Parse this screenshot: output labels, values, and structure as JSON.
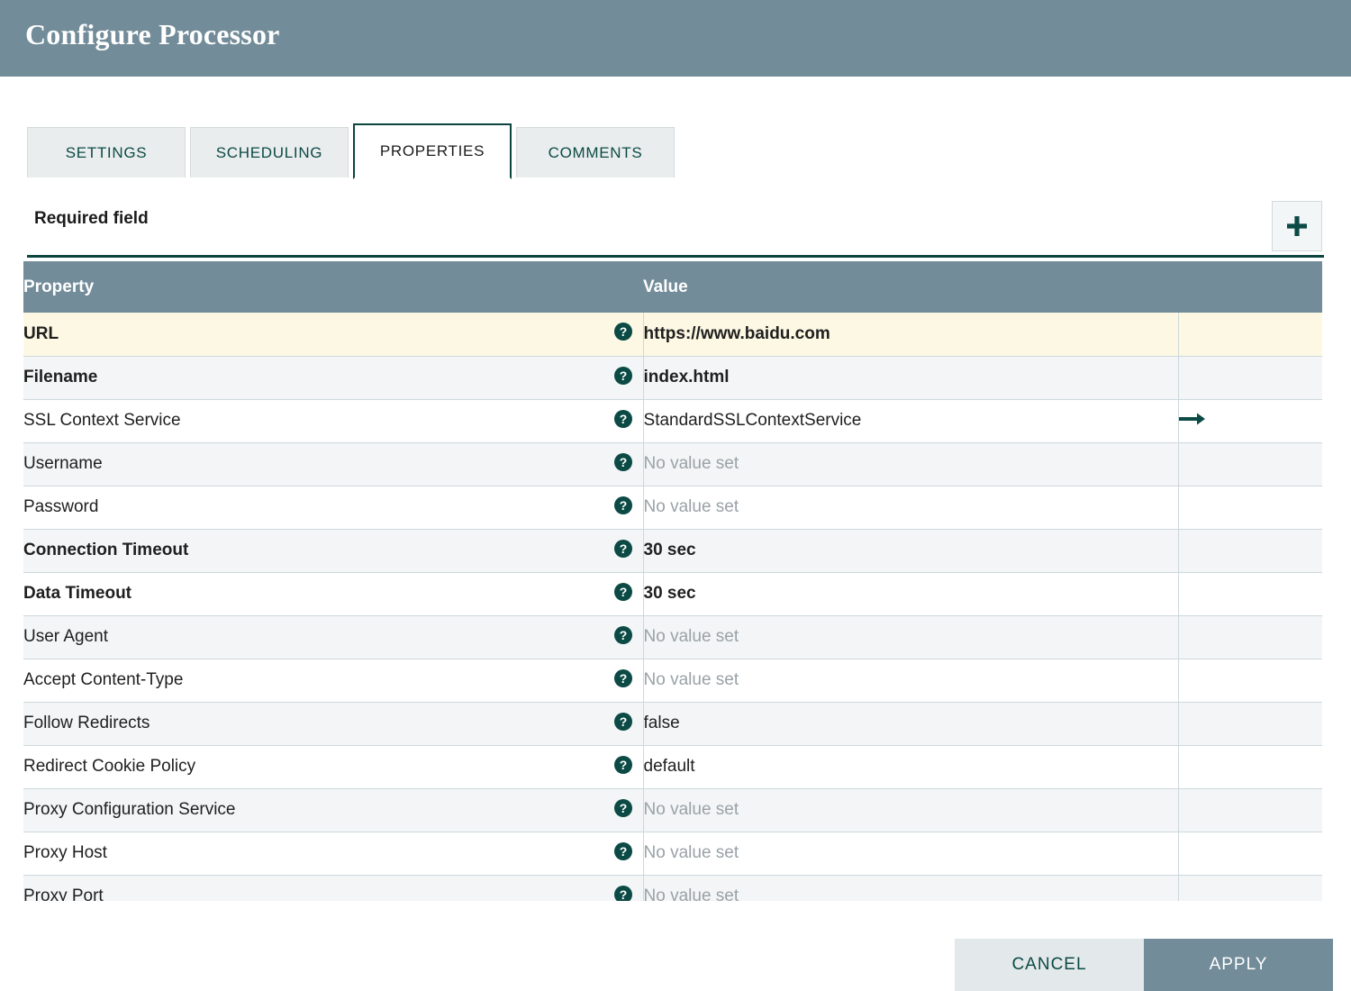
{
  "window": {
    "title": "Configure Processor",
    "header_bg": "#728c99",
    "accent": "#0c4540"
  },
  "tabs": [
    {
      "label": "SETTINGS",
      "active": false
    },
    {
      "label": "SCHEDULING",
      "active": false
    },
    {
      "label": "PROPERTIES",
      "active": true
    },
    {
      "label": "COMMENTS",
      "active": false
    }
  ],
  "toolbar": {
    "required_field_label": "Required field",
    "add_property_icon": "plus-icon"
  },
  "table": {
    "columns": [
      "Property",
      "Value",
      ""
    ],
    "help_icon": "help-circle-icon",
    "goto_icon": "arrow-right-icon",
    "empty_value_text": "No value set",
    "rows": [
      {
        "property": "URL",
        "value": "https://www.baidu.com",
        "required": true,
        "empty": false,
        "highlight": true,
        "action": ""
      },
      {
        "property": "Filename",
        "value": "index.html",
        "required": true,
        "empty": false,
        "highlight": false,
        "action": ""
      },
      {
        "property": "SSL Context Service",
        "value": "StandardSSLContextService",
        "required": false,
        "empty": false,
        "highlight": false,
        "action": "arrow-right-icon"
      },
      {
        "property": "Username",
        "value": "No value set",
        "required": false,
        "empty": true,
        "highlight": false,
        "action": ""
      },
      {
        "property": "Password",
        "value": "No value set",
        "required": false,
        "empty": true,
        "highlight": false,
        "action": ""
      },
      {
        "property": "Connection Timeout",
        "value": "30 sec",
        "required": true,
        "empty": false,
        "highlight": false,
        "action": ""
      },
      {
        "property": "Data Timeout",
        "value": "30 sec",
        "required": true,
        "empty": false,
        "highlight": false,
        "action": ""
      },
      {
        "property": "User Agent",
        "value": "No value set",
        "required": false,
        "empty": true,
        "highlight": false,
        "action": ""
      },
      {
        "property": "Accept Content-Type",
        "value": "No value set",
        "required": false,
        "empty": true,
        "highlight": false,
        "action": ""
      },
      {
        "property": "Follow Redirects",
        "value": "false",
        "required": false,
        "empty": false,
        "highlight": false,
        "action": ""
      },
      {
        "property": "Redirect Cookie Policy",
        "value": "default",
        "required": false,
        "empty": false,
        "highlight": false,
        "action": ""
      },
      {
        "property": "Proxy Configuration Service",
        "value": "No value set",
        "required": false,
        "empty": true,
        "highlight": false,
        "action": ""
      },
      {
        "property": "Proxy Host",
        "value": "No value set",
        "required": false,
        "empty": true,
        "highlight": false,
        "action": ""
      },
      {
        "property": "Proxy Port",
        "value": "No value set",
        "required": false,
        "empty": true,
        "highlight": false,
        "action": ""
      }
    ]
  },
  "footer": {
    "cancel_label": "CANCEL",
    "apply_label": "APPLY"
  }
}
